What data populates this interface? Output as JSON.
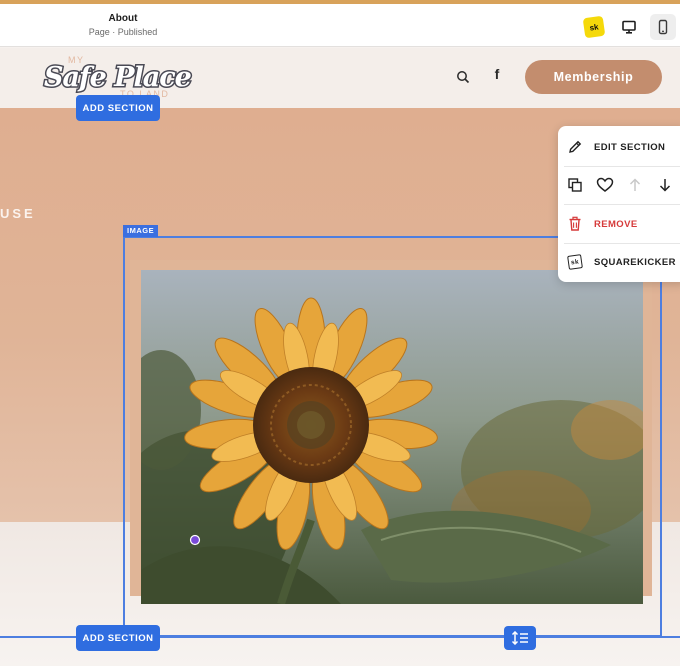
{
  "editor": {
    "page_title": "About",
    "page_status": "Page · Published",
    "sk_badge": "sk",
    "device_desktop_icon": "desktop-icon",
    "device_mobile_icon": "mobile-icon"
  },
  "site": {
    "logo": {
      "top_word": "MY",
      "main": "Safe Place",
      "bottom": "TO LAND"
    },
    "search_icon": "search-icon",
    "facebook_icon": "f",
    "membership_button": "Membership"
  },
  "hero": {
    "partial_text": "USE"
  },
  "editor_overlay": {
    "add_section_top": "ADD SECTION",
    "add_section_bottom": "ADD SECTION",
    "image_tag": "IMAGE",
    "resize_icon": "resize-height-icon"
  },
  "context_menu": {
    "edit_section": "EDIT SECTION",
    "remove": "REMOVE",
    "squarekicker": "SQUAREKICKER",
    "sk_mini": "sk",
    "icons": [
      "duplicate-icon",
      "heart-icon",
      "arrow-up-icon",
      "arrow-down-icon"
    ]
  },
  "colors": {
    "accent_blue": "#2f6de0",
    "membership": "#c38d6e",
    "hero": "#dfae90",
    "remove_red": "#d63a3a"
  }
}
